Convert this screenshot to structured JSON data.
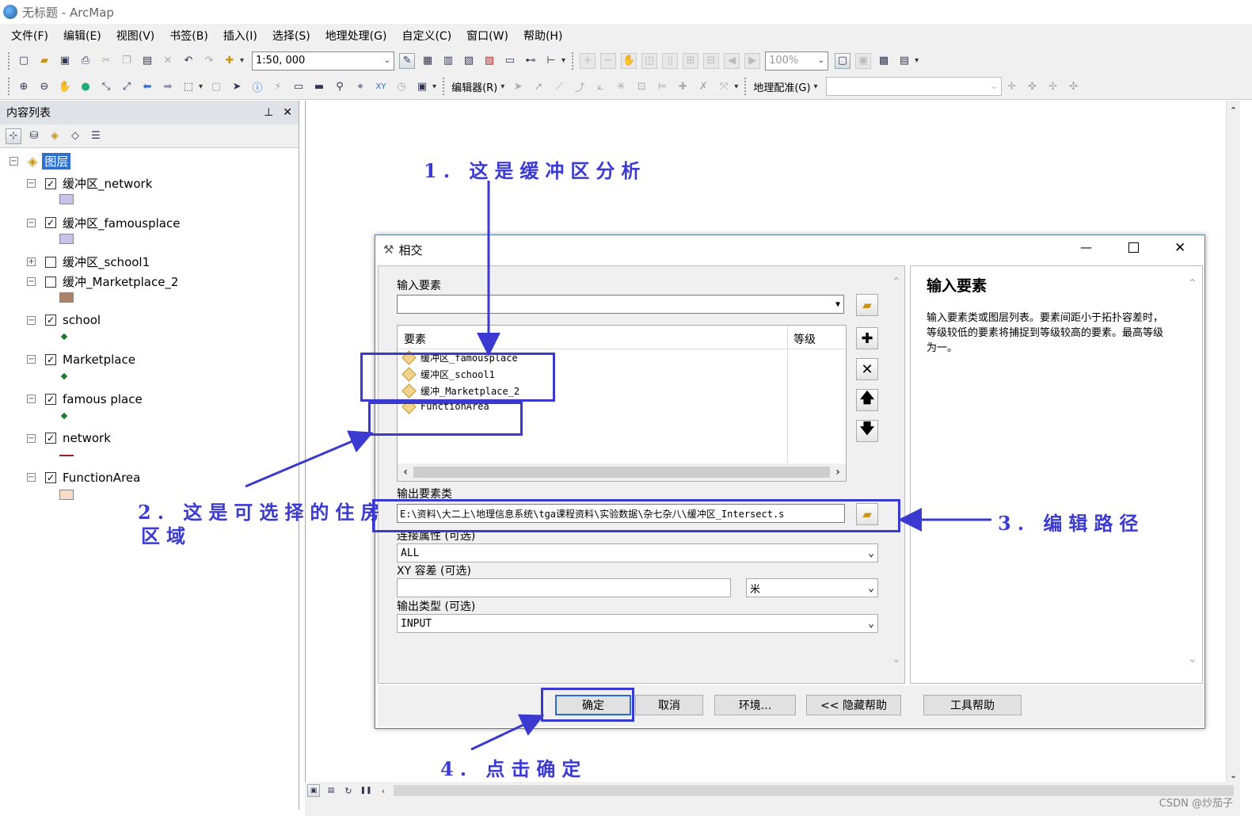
{
  "window": {
    "title": "无标题 - ArcMap"
  },
  "menu": [
    "文件(F)",
    "编辑(E)",
    "视图(V)",
    "书签(B)",
    "插入(I)",
    "选择(S)",
    "地理处理(G)",
    "自定义(C)",
    "窗口(W)",
    "帮助(H)"
  ],
  "toolbar": {
    "scale": "1:50, 000",
    "zoom": "100%",
    "editor_label": "编辑器(R)",
    "georef_label": "地理配准(G)"
  },
  "toc": {
    "title": "内容列表",
    "root": "图层",
    "layers": [
      {
        "name": "缓冲区_network",
        "checked": true,
        "symbol": "poly",
        "color": "#c9c3ea"
      },
      {
        "name": "缓冲区_famousplace",
        "checked": true,
        "symbol": "poly",
        "color": "#c9c3ea"
      },
      {
        "name": "缓冲区_school1",
        "checked": false,
        "symbol": "none"
      },
      {
        "name": "缓冲_Marketplace_2",
        "checked": false,
        "symbol": "poly",
        "color": "#a98468"
      },
      {
        "name": "school",
        "checked": true,
        "symbol": "point",
        "color": "#1e7a2e"
      },
      {
        "name": "Marketplace",
        "checked": true,
        "symbol": "point",
        "color": "#1e7a2e"
      },
      {
        "name": "famous place",
        "checked": true,
        "symbol": "point",
        "color": "#1e7a2e"
      },
      {
        "name": "network",
        "checked": true,
        "symbol": "line",
        "color": "#9b1c2c"
      },
      {
        "name": "FunctionArea",
        "checked": true,
        "symbol": "poly",
        "color": "#f7ddc9"
      }
    ]
  },
  "dialog": {
    "title": "相交",
    "input_label": "输入要素",
    "input_value": "",
    "col_feature": "要素",
    "col_rank": "等级",
    "items": [
      "缓冲区_famousplace",
      "缓冲区_school1",
      "缓冲_Marketplace_2",
      "FunctionArea"
    ],
    "output_label": "输出要素类",
    "output_value": "E:\\资料\\大二上\\地理信息系统\\tga课程资料\\实验数据\\杂七杂八\\缓冲区_Intersect.s",
    "join_label": "连接属性 (可选)",
    "join_value": "ALL",
    "xy_label": "XY 容差 (可选)",
    "xy_value": "",
    "xy_unit": "米",
    "type_label": "输出类型 (可选)",
    "type_value": "INPUT",
    "buttons": {
      "ok": "确定",
      "cancel": "取消",
      "env": "环境...",
      "hide_help": "<< 隐藏帮助",
      "tool_help": "工具帮助"
    },
    "help_title": "输入要素",
    "help_text": "输入要素类或图层列表。要素间距小于拓扑容差时，等级较低的要素将捕捉到等级较高的要素。最高等级为一。"
  },
  "annotations": {
    "a1": "1. 这是缓冲区分析",
    "a2": "2. 这是可选择的住房",
    "a2b": "区域",
    "a3": "3. 编辑路径",
    "a4": "4. 点击确定"
  },
  "watermark": "CSDN @炒茄子"
}
